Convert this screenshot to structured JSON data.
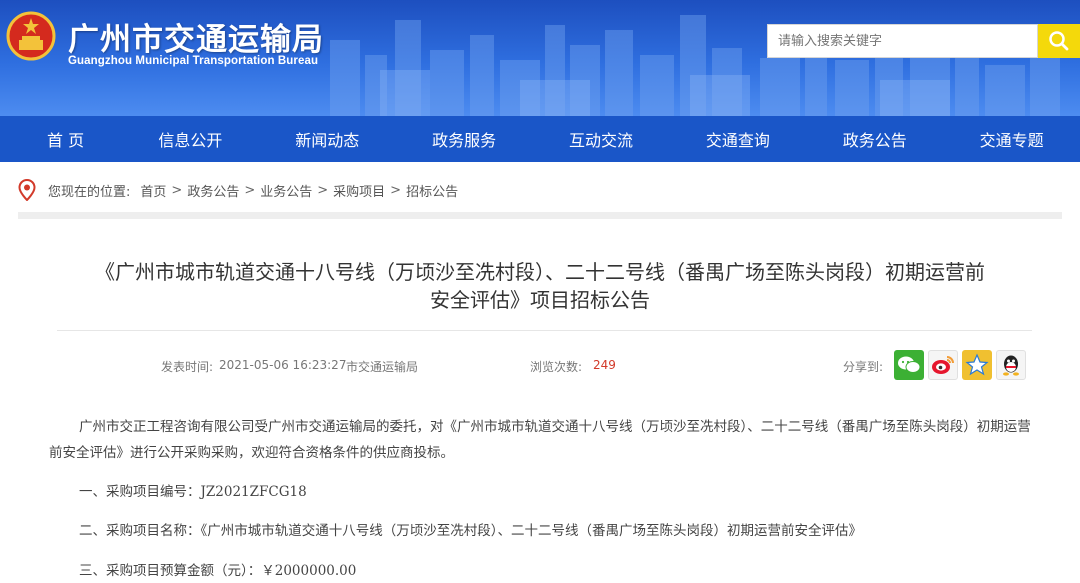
{
  "header": {
    "title": "广州市交通运输局",
    "subtitle": "Guangzhou Municipal Transportation Bureau",
    "logo_icon": "national-emblem-icon",
    "search": {
      "placeholder": "请输入搜索关键字",
      "button_icon": "search-icon"
    }
  },
  "nav": {
    "items": [
      {
        "label": "首 页"
      },
      {
        "label": "信息公开"
      },
      {
        "label": "新闻动态"
      },
      {
        "label": "政务服务"
      },
      {
        "label": "互动交流"
      },
      {
        "label": "交通查询"
      },
      {
        "label": "政务公告"
      },
      {
        "label": "交通专题"
      }
    ]
  },
  "breadcrumb": {
    "icon": "location-pin-icon",
    "label": "您现在的位置:",
    "items": [
      "首页",
      "政务公告",
      "业务公告",
      "采购项目",
      "招标公告"
    ],
    "separator": ">"
  },
  "article": {
    "title_line1": "《广州市城市轨道交通十八号线（万顷沙至冼村段）、二十二号线（番禺广场至陈头岗段）初期运营前",
    "title_line2": "安全评估》项目招标公告",
    "meta": {
      "publish_label": "发表时间:",
      "publish_time": "2021-05-06 16:23:27",
      "publisher": "市交通运输局",
      "views_label": "浏览次数:",
      "views": "249",
      "share_label": "分享到:"
    },
    "share_icons": [
      "wechat-icon",
      "weibo-icon",
      "qzone-icon",
      "qq-icon"
    ],
    "paragraph": "广州市交正工程咨询有限公司受广州市交通运输局的委托，对《广州市城市轨道交通十八号线（万顷沙至冼村段）、二十二号线（番禺广场至陈头岗段）初期运营前安全评估》进行公开采购采购，欢迎符合资格条件的供应商投标。",
    "items": [
      "一、采购项目编号：JZ2021ZFCG18",
      "二、采购项目名称：《广州市城市轨道交通十八号线（万顷沙至冼村段）、二十二号线（番禺广场至陈头岗段）初期运营前安全评估》",
      "三、采购项目预算金额（元）：￥2000000.00"
    ]
  },
  "colors": {
    "nav_bg": "#1a56c8",
    "search_button": "#f4d90b",
    "views_number": "#d23a2a"
  }
}
